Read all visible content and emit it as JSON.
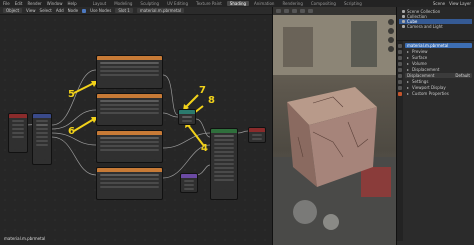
{
  "topbar": {
    "menus": [
      "File",
      "Edit",
      "Render",
      "Window",
      "Help"
    ],
    "tabs": [
      "Layout",
      "Modeling",
      "Sculpting",
      "UV Editing",
      "Texture Paint",
      "Shading",
      "Animation",
      "Rendering",
      "Compositing",
      "Scripting"
    ],
    "active_tab": "Shading",
    "scene": "Scene",
    "view_layer": "View Layer"
  },
  "node_toolbar": {
    "object_menu": "Object",
    "items": [
      "View",
      "Select",
      "Add",
      "Node"
    ],
    "use_nodes": "Use Nodes",
    "slot": "Slot 1",
    "material": "material.m.pbrmetal"
  },
  "node_editor": {
    "status_label": "material.m.pbrmetal",
    "annotations": [
      "5",
      "6",
      "7",
      "8",
      "4"
    ]
  },
  "outliner": {
    "items": [
      "Scene Collection",
      "Collection",
      "Cube",
      "Camera and Light"
    ]
  },
  "properties": {
    "material_name": "material.m.pbrmetal",
    "sections": [
      "Preview",
      "Surface",
      "Volume",
      "Displacement",
      "Settings",
      "Viewport Display",
      "Custom Properties"
    ],
    "displacement_label": "Displacement",
    "displacement_value": "Default"
  },
  "colors": {
    "annotation": "#f2d21a",
    "accent": "#3d6fb5"
  }
}
